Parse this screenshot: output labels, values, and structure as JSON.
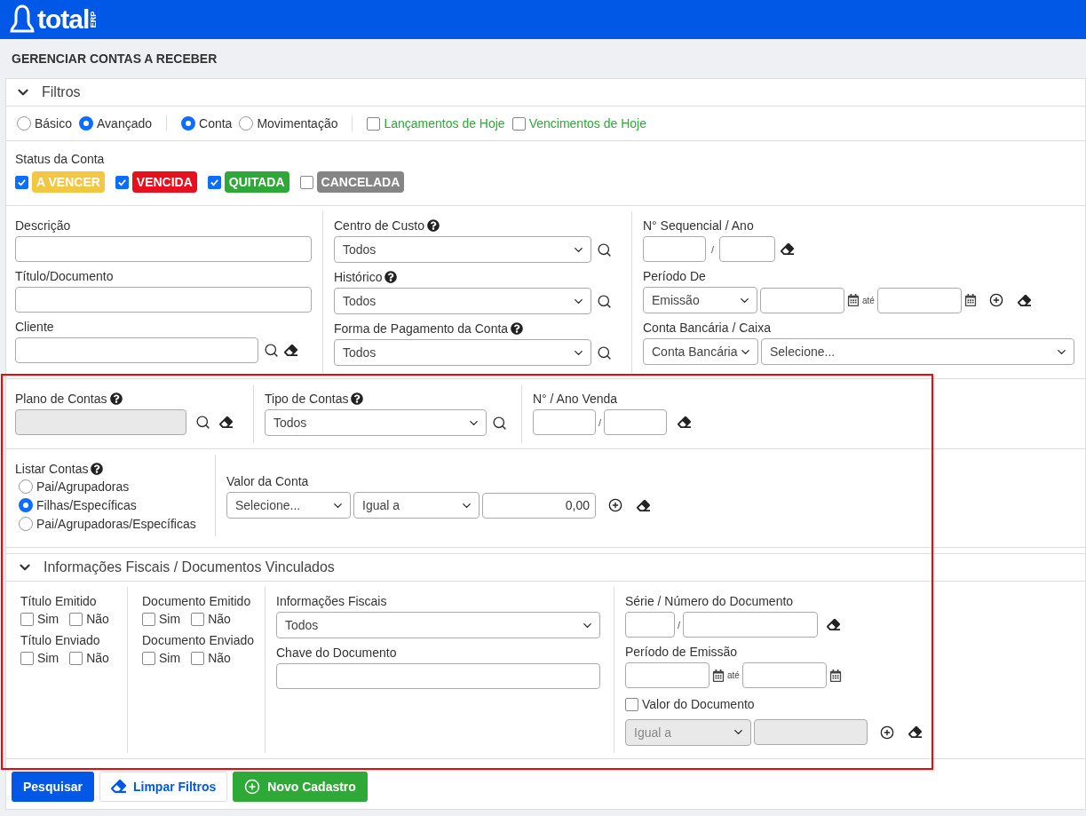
{
  "brand": {
    "name": "total",
    "tag": "ERP"
  },
  "title": "GERENCIAR CONTAS A RECEBER",
  "filters_panel": {
    "title": "Filtros",
    "expanded": true
  },
  "view_modes": [
    {
      "label": "Básico",
      "selected": false
    },
    {
      "label": "Avançado",
      "selected": true
    }
  ],
  "scope_modes": [
    {
      "label": "Conta",
      "selected": true
    },
    {
      "label": "Movimentação",
      "selected": false
    }
  ],
  "quick_filters": [
    {
      "label": "Lançamentos de Hoje",
      "checked": false
    },
    {
      "label": "Vencimentos de Hoje",
      "checked": false
    }
  ],
  "status": {
    "label": "Status da Conta",
    "items": [
      {
        "label": "A VENCER",
        "checked": true,
        "color": "#f2c744"
      },
      {
        "label": "VENCIDA",
        "checked": true,
        "color": "#e8101e"
      },
      {
        "label": "QUITADA",
        "checked": true,
        "color": "#2ea836"
      },
      {
        "label": "CANCELADA",
        "checked": false,
        "color": "#858585"
      }
    ]
  },
  "column_1": [
    {
      "label": "Descrição",
      "kind": "text"
    },
    {
      "label": "Título/Documento",
      "kind": "text"
    },
    {
      "label": "Cliente",
      "kind": "lookup"
    }
  ],
  "column_2": [
    {
      "label": "Centro de Custo",
      "help": true,
      "value": "Todos"
    },
    {
      "label": "Histórico",
      "help": true,
      "value": "Todos"
    },
    {
      "label": "Forma de Pagamento da Conta",
      "help": true,
      "value": "Todos"
    }
  ],
  "sequence": {
    "label": "N° Sequencial / Ano",
    "separator": "/"
  },
  "period": {
    "label": "Período De",
    "type": "Emissão",
    "until": "até"
  },
  "bank": {
    "label": "Conta Bancária / Caixa",
    "type": "Conta Bancária",
    "value": "Selecione..."
  },
  "chart_of_accounts": {
    "label": "Plano de Contas",
    "help": true,
    "disabled": true
  },
  "account_type": {
    "label": "Tipo de Contas",
    "help": true,
    "value": "Todos"
  },
  "sale": {
    "label": "N° / Ano Venda",
    "separator": "/"
  },
  "list_accounts": {
    "label": "Listar Contas",
    "help": true,
    "options": [
      {
        "label": "Pai/Agrupadoras",
        "selected": false
      },
      {
        "label": "Filhas/Específicas",
        "selected": true
      },
      {
        "label": "Pai/Agrupadoras/Específicas",
        "selected": false
      }
    ]
  },
  "account_value": {
    "label": "Valor da Conta",
    "field": "Selecione...",
    "operator": "Igual a",
    "value": "0,00"
  },
  "fiscal": {
    "title": "Informações Fiscais / Documentos Vinculados",
    "expanded": true,
    "flag_columns": [
      [
        {
          "label": "Título Emitido",
          "options": [
            {
              "label": "Sim",
              "checked": false
            },
            {
              "label": "Não",
              "checked": false
            }
          ]
        },
        {
          "label": "Título Enviado",
          "options": [
            {
              "label": "Sim",
              "checked": false
            },
            {
              "label": "Não",
              "checked": false
            }
          ]
        }
      ],
      [
        {
          "label": "Documento Emitido",
          "options": [
            {
              "label": "Sim",
              "checked": false
            },
            {
              "label": "Não",
              "checked": false
            }
          ]
        },
        {
          "label": "Documento Enviado",
          "options": [
            {
              "label": "Sim",
              "checked": false
            },
            {
              "label": "Não",
              "checked": false
            }
          ]
        }
      ]
    ],
    "info": {
      "label": "Informações Fiscais",
      "value": "Todos"
    },
    "key": {
      "label": "Chave do Documento"
    },
    "series": {
      "label": "Série / Número do Documento",
      "separator": "/"
    },
    "period": {
      "label": "Período de Emissão",
      "until": "até"
    },
    "doc_value": {
      "label": "Valor do Documento",
      "checked": false,
      "operator": "Igual a"
    }
  },
  "actions": [
    {
      "label": "Pesquisar",
      "kind": "primary"
    },
    {
      "label": "Limpar Filtros",
      "kind": "clear"
    },
    {
      "label": "Novo Cadastro",
      "kind": "create"
    }
  ]
}
